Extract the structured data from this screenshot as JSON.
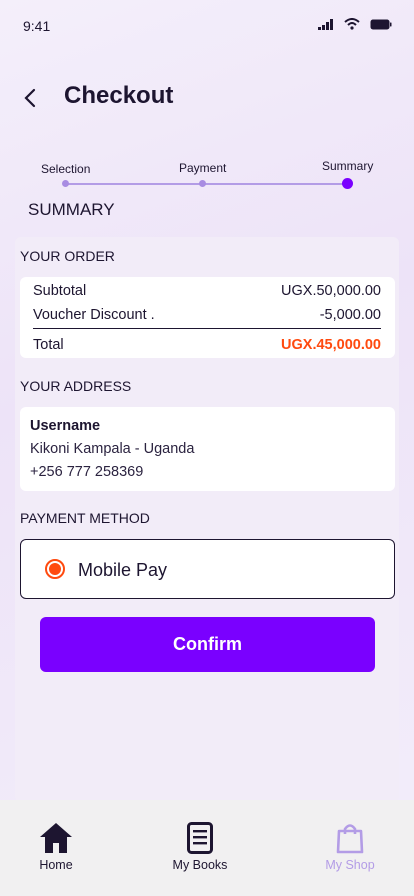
{
  "status_bar": {
    "time": "9:41"
  },
  "header": {
    "title": "Checkout"
  },
  "stepper": {
    "steps": [
      "Selection",
      "Payment",
      "Summary"
    ],
    "active_step": "Summary"
  },
  "summary_heading": "SUMMARY",
  "order": {
    "title": "YOUR ORDER",
    "subtotal_label": "Subtotal",
    "subtotal_value": "UGX.50,000.00",
    "discount_label": "Voucher Discount .",
    "discount_value": "-5,000.00",
    "total_label": "Total",
    "total_value": "UGX.45,000.00"
  },
  "address": {
    "title": "YOUR ADDRESS",
    "name": "Username",
    "line1": "Kikoni Kampala - Uganda",
    "phone": "+256 777 258369"
  },
  "payment": {
    "title": "PAYMENT METHOD",
    "option_label": "Mobile Pay"
  },
  "confirm_label": "Confirm",
  "nav": {
    "home": "Home",
    "books": "My Books",
    "shop": "My Shop"
  },
  "colors": {
    "accent": "#7a00ff",
    "total": "#ff4a0f",
    "inactive_nav": "#b39ce6"
  }
}
